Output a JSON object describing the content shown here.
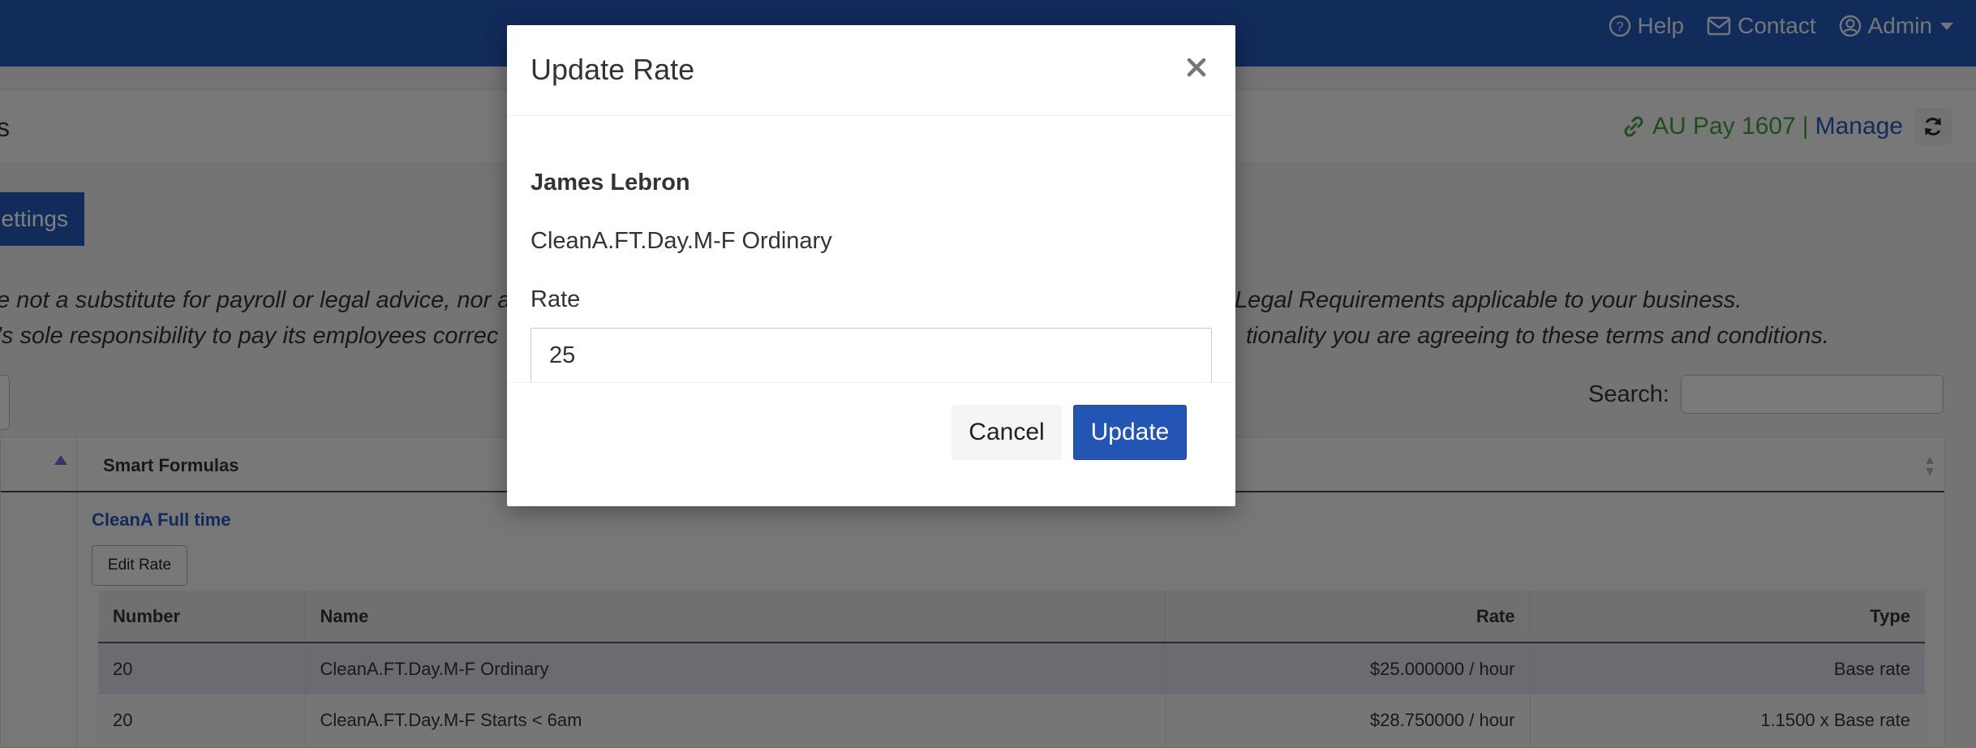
{
  "colors": {
    "brand": "#2356b4",
    "integration_green": "#3c9a3c",
    "backdrop": "rgba(0,0,0,0.5)"
  },
  "nav": {
    "items": [
      {
        "label": "Help",
        "icon": "question-circle-icon"
      },
      {
        "label": "Contact",
        "icon": "envelope-icon"
      },
      {
        "label": "Admin",
        "icon": "user-circle-icon"
      }
    ]
  },
  "subheader": {
    "title_fragment": "s",
    "integration_label": "AU Pay 1607",
    "separator": "|",
    "manage_label": "Manage"
  },
  "settings_button": "ettings",
  "disclaimer": {
    "line1_left": "e not a substitute for payroll or legal advice, nor a",
    "line1_right": "Legal Requirements applicable to your business.",
    "line2_left": "’s sole responsibility to pay its employees correc",
    "line2_right": "tionality you are agreeing to these terms and conditions."
  },
  "search": {
    "label": "Search:",
    "value": ""
  },
  "grid": {
    "header_label": "Smart Formulas",
    "group_title": "CleanA Full time",
    "edit_rate_label": "Edit Rate",
    "columns": [
      "Number",
      "Name",
      "Rate",
      "Type"
    ],
    "rows": [
      {
        "number": "20",
        "name": "CleanA.FT.Day.M-F Ordinary",
        "rate": "$25.000000 / hour",
        "type": "Base rate"
      },
      {
        "number": "20",
        "name": "CleanA.FT.Day.M-F Starts < 6am",
        "rate": "$28.750000 / hour",
        "type": "1.1500 x Base rate"
      }
    ]
  },
  "modal": {
    "title": "Update Rate",
    "employee_name": "James Lebron",
    "rate_name": "CleanA.FT.Day.M-F Ordinary",
    "rate_label": "Rate",
    "rate_value": "25",
    "cancel_label": "Cancel",
    "update_label": "Update"
  }
}
